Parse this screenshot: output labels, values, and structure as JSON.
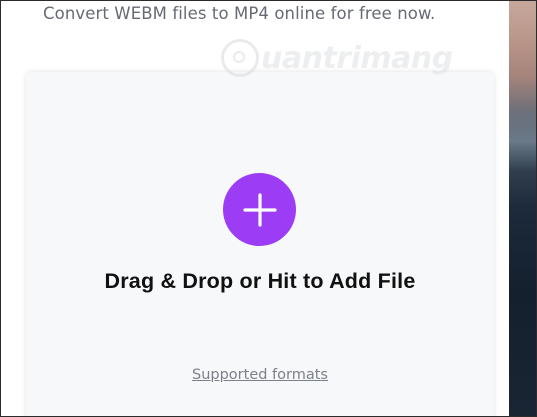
{
  "header": {
    "subtitle": "Convert WEBM files to MP4 online for free now."
  },
  "watermark": {
    "text": "uantrimang",
    "icon": "logo-icon"
  },
  "upload": {
    "add_icon": "plus-icon",
    "cta_label": "Drag & Drop or Hit to Add File",
    "formats_link": "Supported formats"
  },
  "colors": {
    "accent": "#9c3cf5",
    "card_bg": "#f7f8f9",
    "subtitle": "#666a73",
    "link": "#7c8089"
  }
}
